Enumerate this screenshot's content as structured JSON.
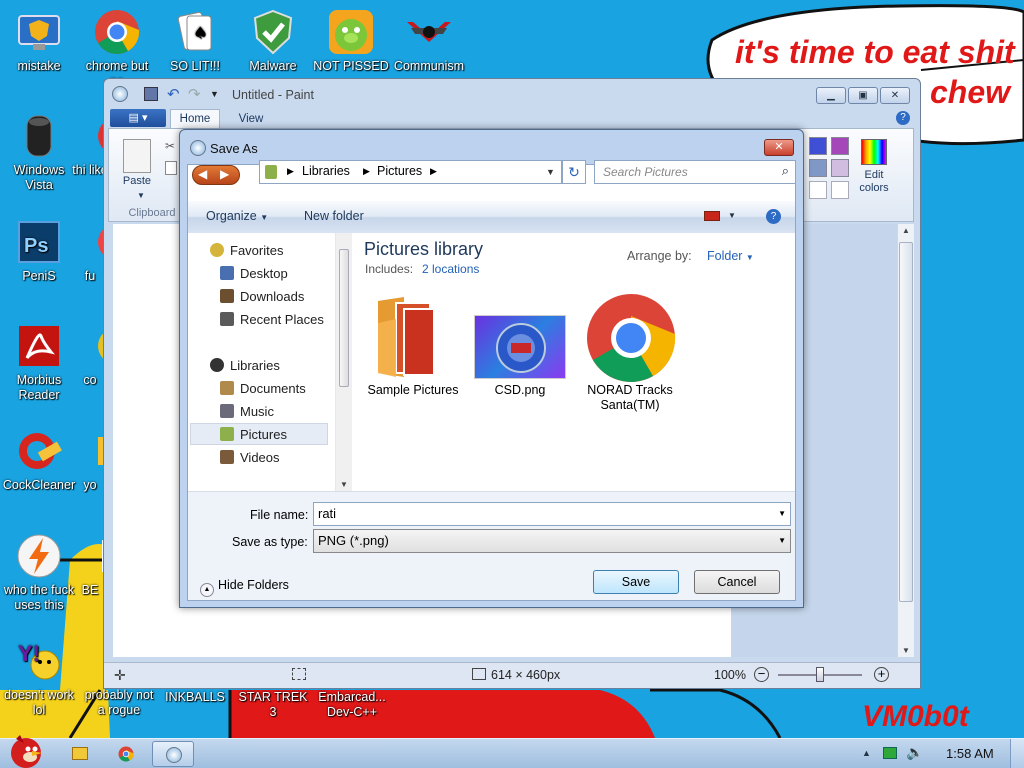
{
  "desktop": {
    "bubble_line1": "it's time to eat shit",
    "bubble_line2": "chew",
    "signature": "VM0b0t",
    "icons": [
      {
        "label": "mistake",
        "icon": "monitor-shield-icon"
      },
      {
        "label": "chrome but no",
        "icon": "chrome-icon"
      },
      {
        "label": "SO LIT!!!",
        "icon": "solitaire-cards-icon"
      },
      {
        "label": "Malware",
        "icon": "security-shield-icon"
      },
      {
        "label": "NOT PISSED",
        "icon": "angry-pig-icon"
      },
      {
        "label": "Communism",
        "icon": "wing-emblem-icon"
      },
      {
        "label": "Windows Vista",
        "icon": "vista-orb-icon"
      },
      {
        "label": "thi like",
        "icon": "partial-icon"
      },
      {
        "label": "PeniS",
        "icon": "photoshop-icon"
      },
      {
        "label": "fu",
        "icon": "partial-icon"
      },
      {
        "label": "Morbius Reader",
        "icon": "pdf-reader-icon"
      },
      {
        "label": "co",
        "icon": "partial-icon"
      },
      {
        "label": "CockCleaner",
        "icon": "ccleaner-brush-icon"
      },
      {
        "label": "yo",
        "icon": "partial-icon"
      },
      {
        "label": "who the fuck uses this",
        "icon": "winamp-bolt-icon"
      },
      {
        "label": "BE",
        "icon": "partial-icon"
      },
      {
        "label": "doesn't work lol",
        "icon": "yahoo-messenger-icon"
      },
      {
        "label": "probably not a rogue",
        "icon": "shield-blue-icon"
      },
      {
        "label": "INKBALLS",
        "icon": "game-icon"
      },
      {
        "label": "STAR TREK 3",
        "icon": "game-icon"
      },
      {
        "label": "Embarcad... Dev-C++",
        "icon": "devcpp-icon"
      }
    ]
  },
  "paint": {
    "title": "Untitled - Paint",
    "tabs": [
      "Home",
      "View"
    ],
    "clipboard": {
      "paste_label": "Paste",
      "group_label": "Clipboard"
    },
    "edit_colors": "Edit colors",
    "dimensions": "614 × 460px",
    "zoom": "100%"
  },
  "dialog": {
    "title": "Save As",
    "breadcrumb": [
      "Libraries",
      "Pictures"
    ],
    "search_placeholder": "Search Pictures",
    "organize": "Organize",
    "new_folder": "New folder",
    "nav": {
      "favorites": "Favorites",
      "favorites_items": [
        "Desktop",
        "Downloads",
        "Recent Places"
      ],
      "libraries": "Libraries",
      "libraries_items": [
        "Documents",
        "Music",
        "Pictures",
        "Videos"
      ]
    },
    "library_title": "Pictures library",
    "includes_label": "Includes:",
    "includes_link": "2 locations",
    "arrange_label": "Arrange by:",
    "arrange_value": "Folder",
    "files": [
      {
        "name": "Sample Pictures",
        "icon": "folder-pictures-icon"
      },
      {
        "name": "CSD.png",
        "icon": "image-thumbnail-icon"
      },
      {
        "name": "NORAD Tracks Santa(TM)",
        "icon": "chrome-icon"
      }
    ],
    "file_name_label": "File name:",
    "file_name_value": "rati",
    "save_type_label": "Save as type:",
    "save_type_value": "PNG (*.png)",
    "hide_folders": "Hide Folders",
    "save": "Save",
    "cancel": "Cancel"
  },
  "taskbar": {
    "clock": "1:58 AM",
    "buttons": [
      "explorer-icon",
      "chrome-icon",
      "paint-icon"
    ]
  }
}
